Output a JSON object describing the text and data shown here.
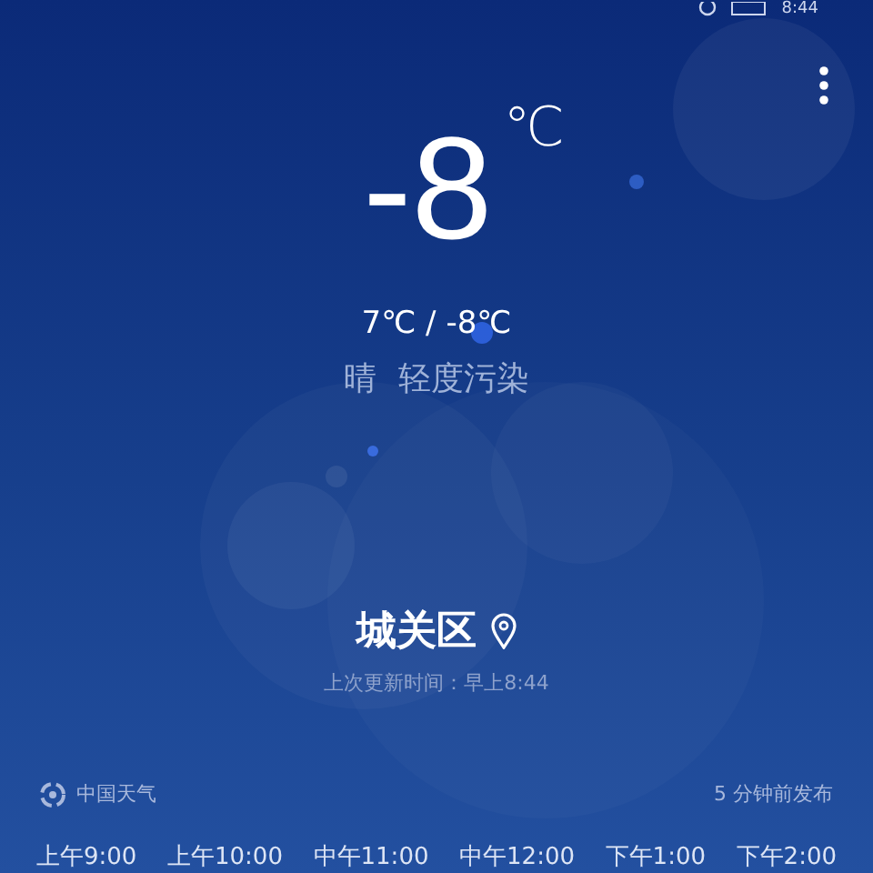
{
  "status_bar": {
    "time": "8:44"
  },
  "current": {
    "temperature": "-8",
    "unit": "℃",
    "range": "7℃ / -8℃",
    "condition": "晴",
    "air_quality": "轻度污染"
  },
  "location": {
    "city": "城关区",
    "updated": "上次更新时间：早上8:44"
  },
  "source": {
    "name": "中国天气",
    "published": "5 分钟前发布"
  },
  "hours": [
    "上午9:00",
    "上午10:00",
    "中午11:00",
    "中午12:00",
    "下午1:00",
    "下午2:00"
  ]
}
